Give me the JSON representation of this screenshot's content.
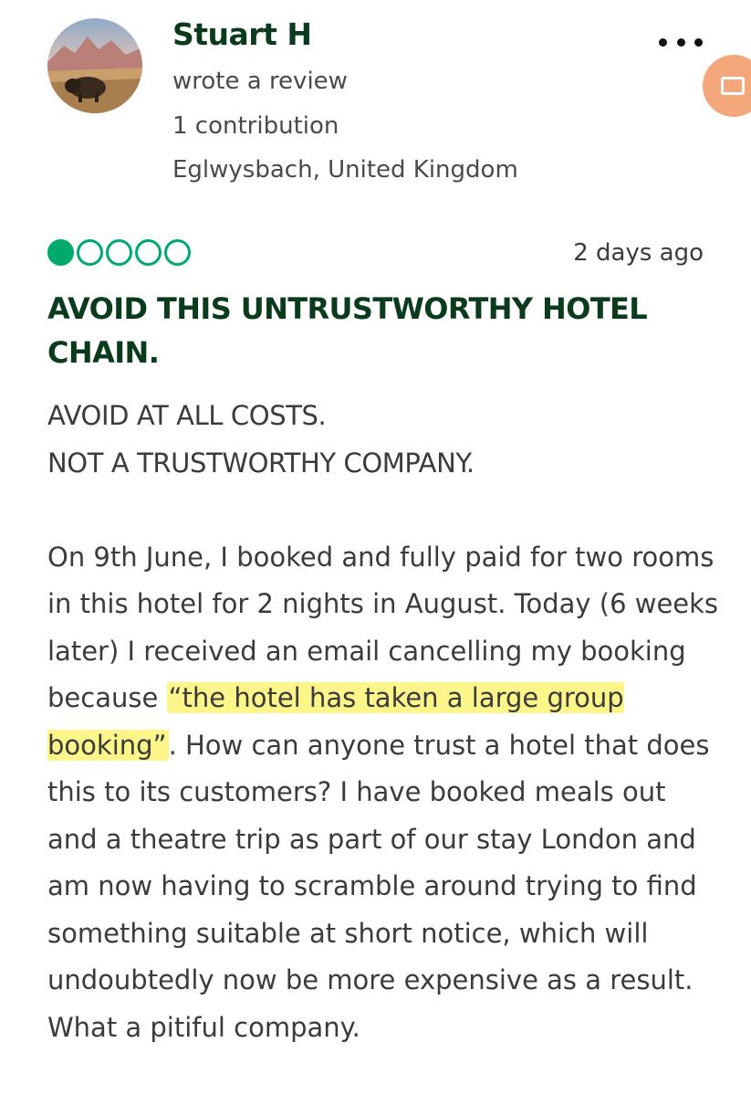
{
  "reviewer": {
    "name": "Stuart H",
    "action": "wrote a review",
    "contributions": "1 contribution",
    "location": "Eglwysbach, United Kingdom"
  },
  "review": {
    "rating": 1,
    "rating_max": 5,
    "date": "2 days ago",
    "title": "AVOID THIS UNTRUSTWORTHY HOTEL CHAIN.",
    "intro_line1": "AVOID AT ALL COSTS.",
    "intro_line2": "NOT A TRUSTWORTHY COMPANY.",
    "body_before_highlight": "On 9th June, I booked and fully paid for two rooms in this hotel for 2 nights in August. Today (6 weeks later) I received an email cancelling my booking because ",
    "highlight": "“the hotel has taken a large group booking”",
    "body_after_highlight": ". How can anyone trust a hotel that does this to its customers? I  have booked meals out and a theatre trip as part of our stay London and am now having to scramble around trying to find something suitable at short notice, which will undoubtedly now be more expensive as a result. What a pitiful company."
  },
  "colors": {
    "rating_green": "#00aa6c",
    "title_green": "#0b3b1d",
    "highlight_yellow": "#fbf58a",
    "fab_orange": "#f5a77c"
  },
  "icons": {
    "more": "more-dots-icon",
    "fab": "camera-icon"
  }
}
